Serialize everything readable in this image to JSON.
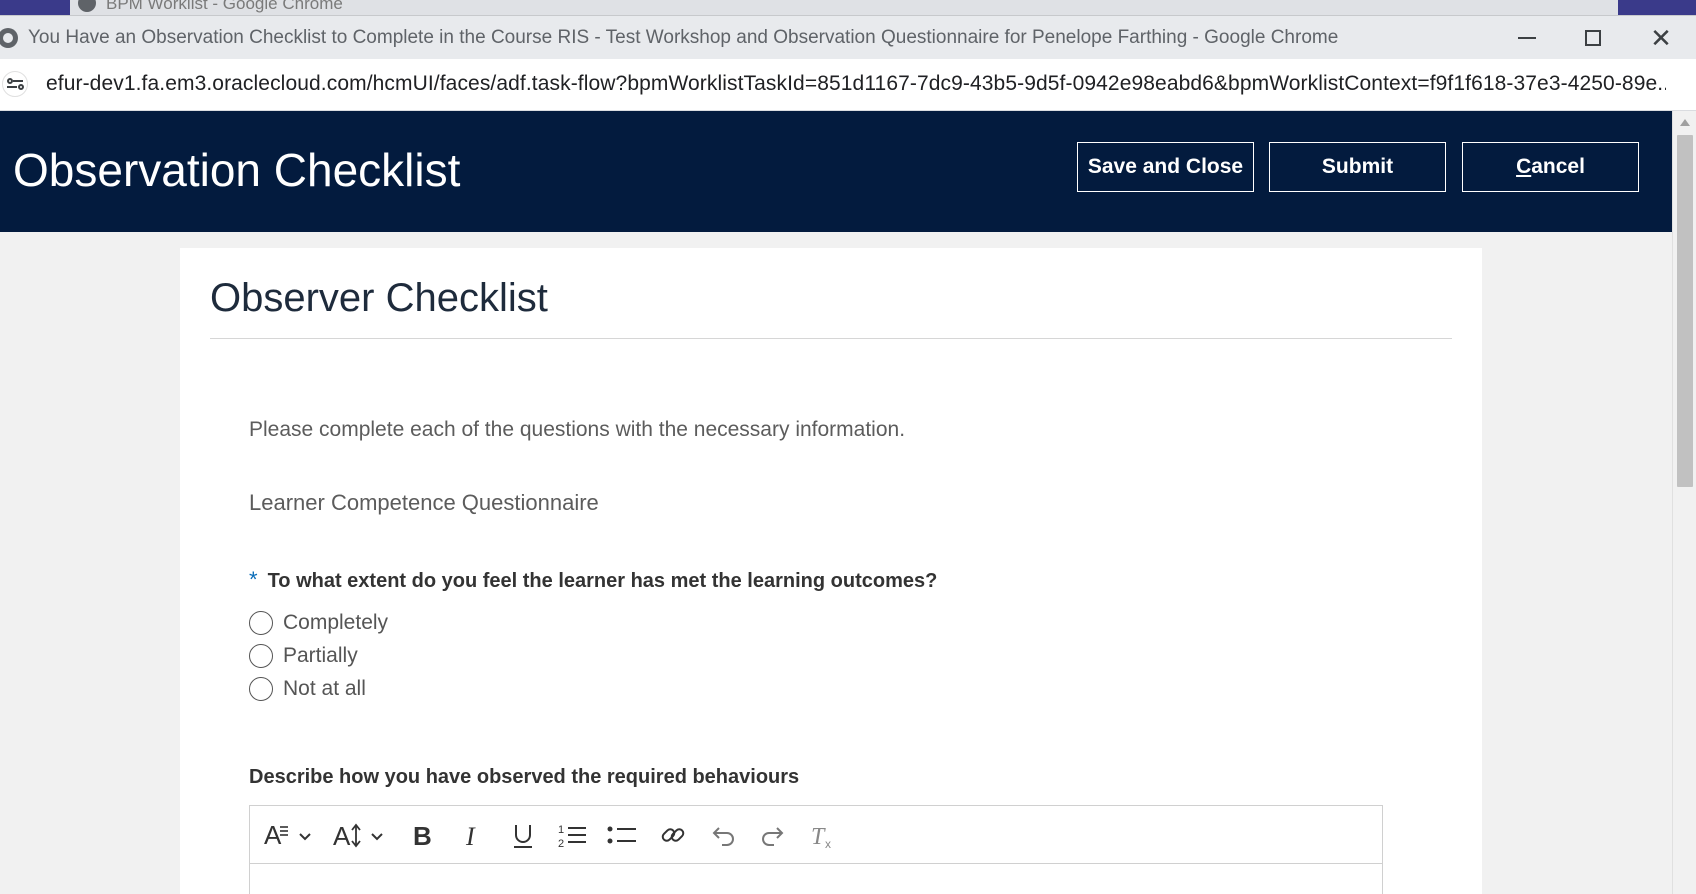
{
  "background_window": {
    "tab_title": "BPM Worklist - Google Chrome"
  },
  "window": {
    "title": "You Have an Observation Checklist to Complete in the Course RIS - Test Workshop and Observation Questionnaire for Penelope Farthing - Google Chrome",
    "minimize_icon": "minimize-icon",
    "maximize_icon": "maximize-icon",
    "close_icon": "close-icon",
    "close_glyph": "✕"
  },
  "address_bar": {
    "url": "efur-dev1.fa.em3.oraclecloud.com/hcmUI/faces/adf.task-flow?bpmWorklistTaskId=851d1167-7dc9-43b5-9d5f-0942e98eabd6&bpmWorklistContext=f9f1f618-37e3-4250-89e..."
  },
  "header": {
    "title": "Observation Checklist",
    "save_close_label": "Save and Close",
    "submit_label": "Submit",
    "cancel_mnemonic": "C",
    "cancel_rest": "ancel",
    "background_color": "#031b3e"
  },
  "panel": {
    "title": "Observer Checklist",
    "instruction": "Please complete each of the questions with the necessary information.",
    "section_heading": "Learner Competence Questionnaire",
    "question1": {
      "required_marker": "*",
      "text": "To what extent do you feel the learner has met the learning outcomes?",
      "options": [
        "Completely",
        "Partially",
        "Not at all"
      ],
      "selected": null
    },
    "question2": {
      "text": "Describe how you have observed the required behaviours"
    }
  },
  "editor_toolbar": {
    "tools": [
      "font-family-icon",
      "font-size-icon",
      "bold-icon",
      "italic-icon",
      "underline-icon",
      "ordered-list-icon",
      "bullet-list-icon",
      "link-icon",
      "undo-icon",
      "redo-icon",
      "clear-format-icon"
    ]
  },
  "colors": {
    "accent": "#0a6cb8",
    "header_bg": "#031b3e",
    "page_bg": "#f1f1f1"
  }
}
